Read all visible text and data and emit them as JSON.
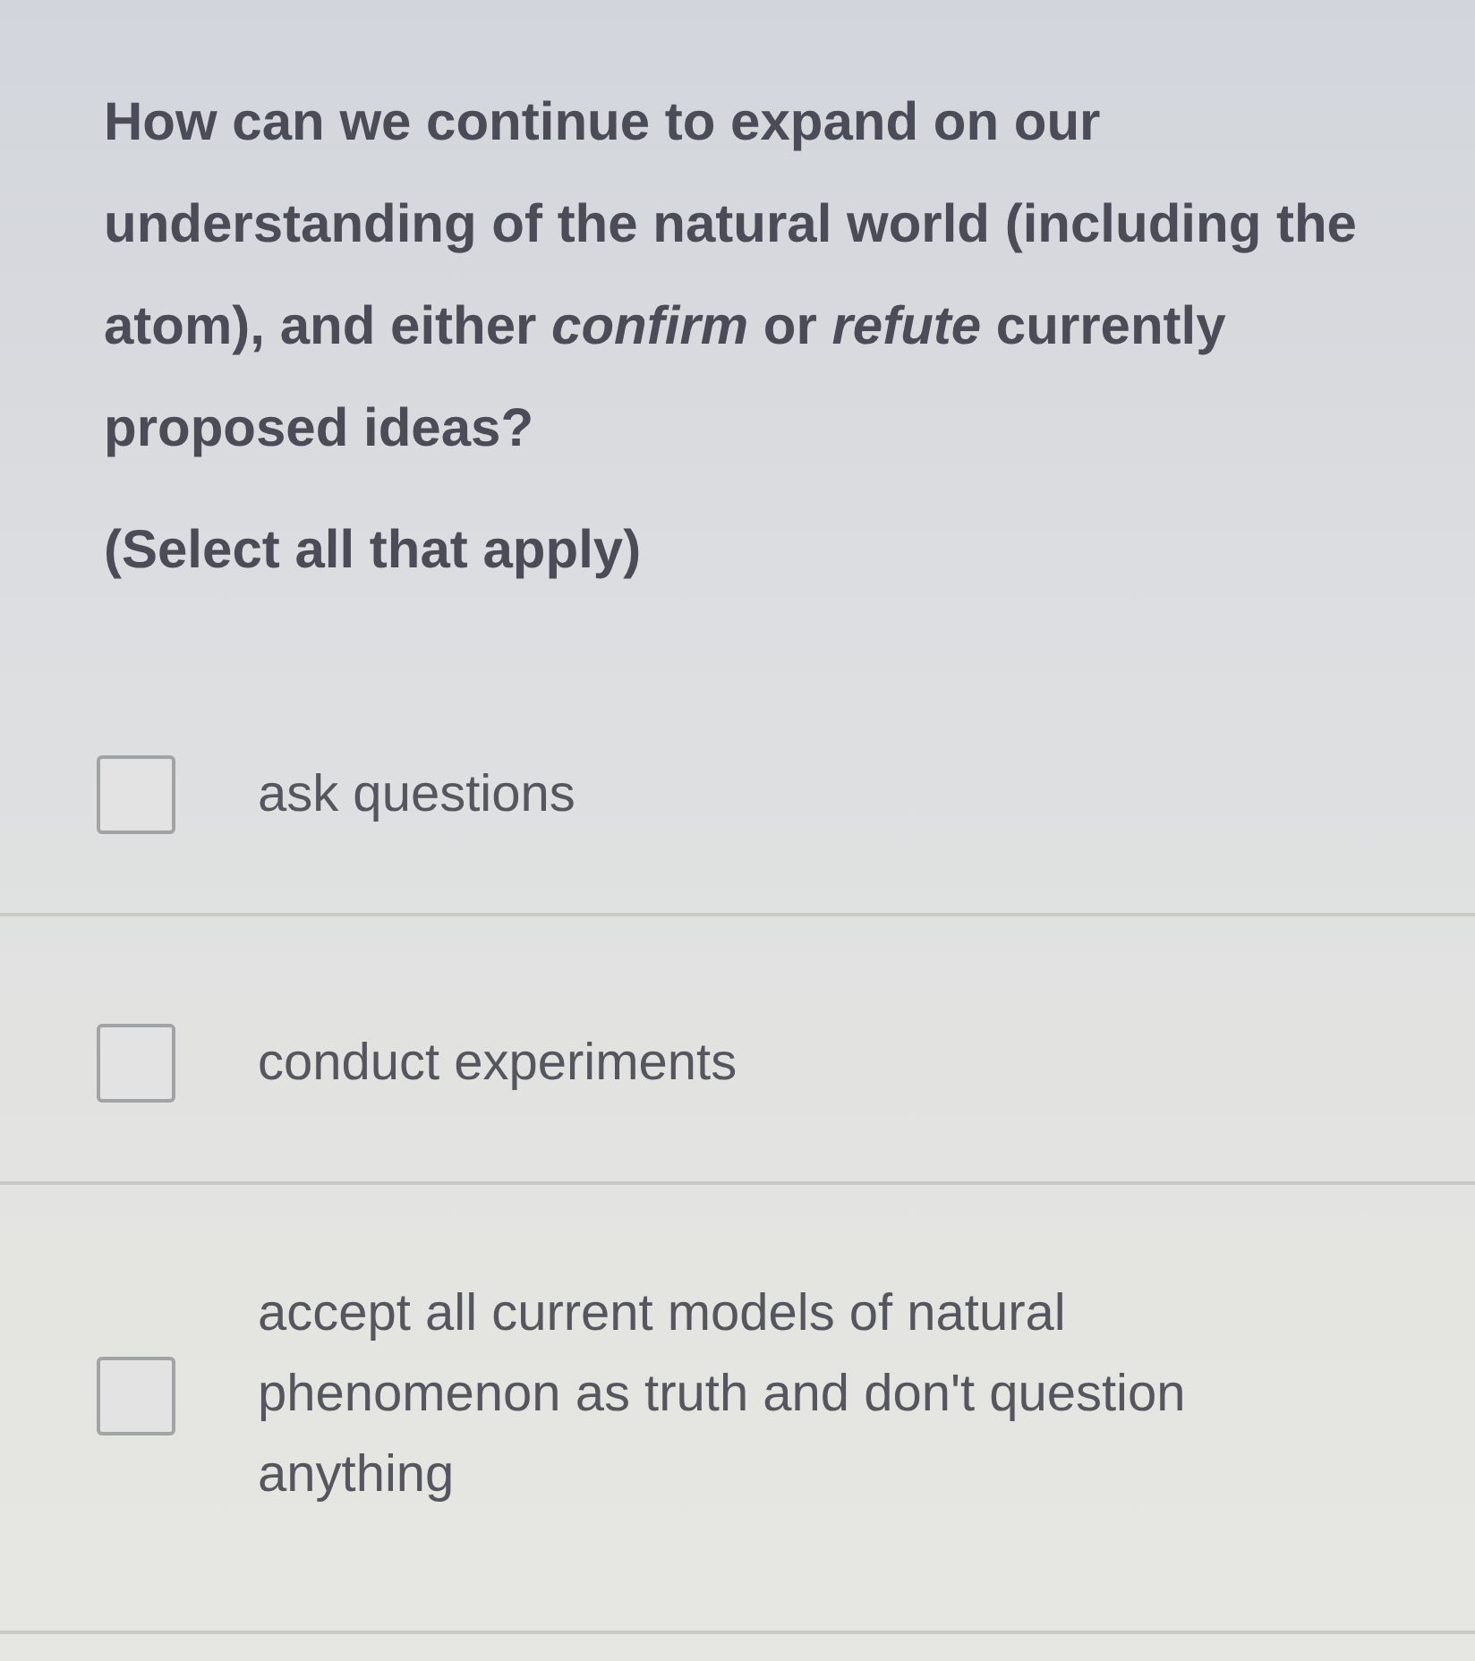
{
  "question": {
    "text": "How can we continue to expand on our understanding of the natural world (including the atom), and either *confirm* or *refute* currently proposed ideas?",
    "instruction": "(Select all that apply)"
  },
  "options": [
    {
      "label": "ask questions",
      "checked": false
    },
    {
      "label": "conduct experiments",
      "checked": false
    },
    {
      "label": "accept all current models of natural phenomenon as truth and don't question anything",
      "checked": false
    }
  ]
}
